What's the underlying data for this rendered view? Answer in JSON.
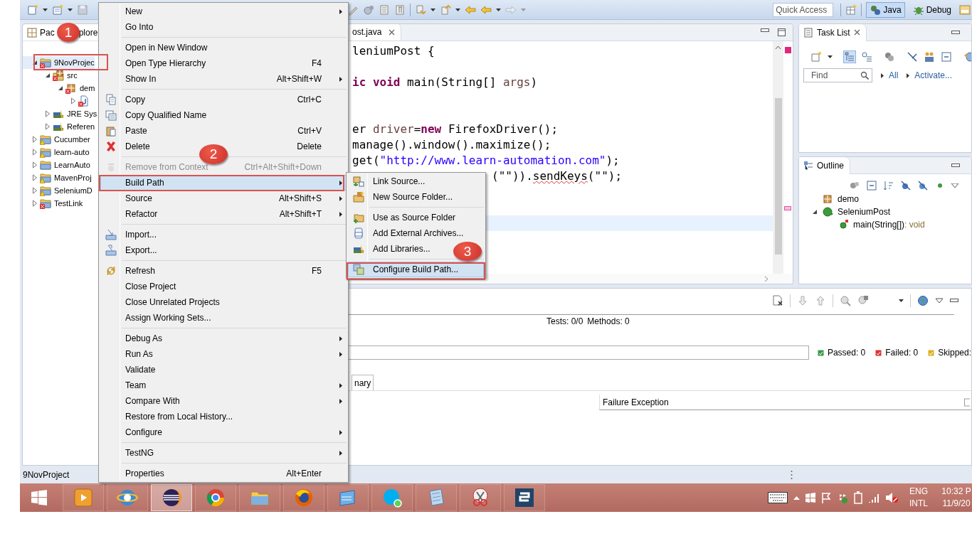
{
  "toolbar": {
    "quick_access": {
      "placeholder": "Quick Access"
    },
    "perspectives": [
      {
        "label": "Java",
        "selected": true
      },
      {
        "label": "Debug",
        "selected": false
      }
    ]
  },
  "package_explorer": {
    "title_parts": [
      "Pac",
      "plore"
    ],
    "tree": [
      {
        "label": "9NovProjec",
        "kind": "project",
        "error": true,
        "warning": false,
        "expanded": true,
        "selected": true,
        "children": [
          {
            "label": "src",
            "kind": "source-folder",
            "error": true,
            "warning": false,
            "expanded": true,
            "selected": false,
            "children": [
              {
                "label": "dem",
                "kind": "package",
                "error": true,
                "warning": false,
                "expanded": true,
                "selected": false,
                "children": [
                  {
                    "kind": "file",
                    "error": true,
                    "warning": false,
                    "expanded": false,
                    "selected": false
                  }
                ]
              }
            ]
          },
          {
            "label": "JRE Sys",
            "kind": "library",
            "error": false,
            "warning": false,
            "expanded": false,
            "selected": false
          },
          {
            "label": "Referen",
            "kind": "library",
            "error": false,
            "warning": false,
            "expanded": false,
            "selected": false
          }
        ]
      },
      {
        "label": "Cucumber",
        "kind": "project",
        "error": false,
        "warning": true,
        "expanded": false,
        "selected": false
      },
      {
        "label": "learn-auto",
        "kind": "project",
        "error": false,
        "warning": true,
        "expanded": false,
        "selected": false
      },
      {
        "label": "LearnAuto",
        "kind": "project",
        "error": false,
        "warning": false,
        "expanded": false,
        "selected": false
      },
      {
        "label": "MavenProj",
        "kind": "project",
        "error": false,
        "warning": true,
        "expanded": false,
        "selected": false
      },
      {
        "label": "SeleniumD",
        "kind": "project",
        "error": false,
        "warning": true,
        "expanded": false,
        "selected": false
      },
      {
        "label": "TestLink",
        "kind": "project",
        "error": true,
        "warning": false,
        "expanded": false,
        "selected": false
      }
    ]
  },
  "editor": {
    "tab": {
      "label": "ost.java"
    },
    "lines": [
      {
        "current": false,
        "segments": [
          {
            "kind": "plain",
            "text": "leniumPost {"
          }
        ]
      },
      {
        "current": false
      },
      {
        "current": false,
        "segments": [
          {
            "kind": "keyword",
            "text": "ic void"
          },
          {
            "kind": "plain",
            "text": " main(String[] "
          },
          {
            "kind": "variable",
            "text": "args"
          },
          {
            "kind": "plain",
            "text": ")"
          }
        ]
      },
      {
        "current": false
      },
      {
        "current": false
      },
      {
        "current": false,
        "segments": [
          {
            "kind": "plain",
            "text": "er "
          },
          {
            "kind": "variable",
            "text": "driver"
          },
          {
            "kind": "plain",
            "text": "="
          },
          {
            "kind": "keyword",
            "text": "new"
          },
          {
            "kind": "plain",
            "text": " FirefoxDriver();"
          }
        ]
      },
      {
        "current": false,
        "segments": [
          {
            "kind": "plain",
            "text": "manage().window().maximize();"
          }
        ]
      },
      {
        "current": false,
        "segments": [
          {
            "kind": "plain",
            "text": "get("
          },
          {
            "kind": "string",
            "text": "\"http://www.learn-automation.com\""
          },
          {
            "kind": "plain",
            "text": ");"
          }
        ]
      },
      {
        "current": false,
        "covered": true,
        "segments": [
          {
            "kind": "plain",
            "text": "(\"\"))."
          },
          {
            "kind": "warning",
            "text": "sendKeys"
          },
          {
            "kind": "plain",
            "text": "(\"\");"
          }
        ]
      },
      {
        "current": false
      },
      {
        "current": false
      },
      {
        "current": true
      }
    ]
  },
  "task_list": {
    "title": "Task List",
    "find": {
      "placeholder": "Find"
    },
    "links": [
      "All",
      "Activate..."
    ]
  },
  "outline": {
    "title": "Outline",
    "tree": [
      {
        "label": "demo",
        "kind": "package"
      },
      {
        "label": "SeleniumPost",
        "kind": "class",
        "expanded": true,
        "children": [
          {
            "label": "main(String[])",
            "type": " : void",
            "kind": "method"
          }
        ]
      }
    ]
  },
  "testng": {
    "tests": "Tests: 0/0",
    "methods": "Methods: 0",
    "progress": {
      "level": 0
    },
    "counters": [
      {
        "kind": "passed",
        "label": "Passed: 0"
      },
      {
        "kind": "failed",
        "label": "Failed: 0"
      },
      {
        "kind": "skipped",
        "label": "Skipped:"
      }
    ],
    "tab": "nary",
    "column": "Failure Exception"
  },
  "status_bar": {
    "text": "9NovProject"
  },
  "context_menu": {
    "items": [
      {
        "kind": "item",
        "label": "New",
        "submenu": true,
        "disabled": false,
        "selected": false
      },
      {
        "kind": "item",
        "label": "Go Into",
        "submenu": false,
        "disabled": false,
        "selected": false
      },
      {
        "kind": "separator"
      },
      {
        "kind": "item",
        "label": "Open in New Window",
        "submenu": false,
        "disabled": false,
        "selected": false
      },
      {
        "kind": "item",
        "label": "Open Type Hierarchy",
        "shortcut": "F4",
        "submenu": false,
        "disabled": false,
        "selected": false
      },
      {
        "kind": "item",
        "label": "Show In",
        "shortcut": "Alt+Shift+W",
        "submenu": true,
        "disabled": false,
        "selected": false
      },
      {
        "kind": "separator"
      },
      {
        "kind": "item",
        "label": "Copy",
        "shortcut": "Ctrl+C",
        "submenu": false,
        "disabled": false,
        "selected": false
      },
      {
        "kind": "item",
        "label": "Copy Qualified Name",
        "submenu": false,
        "disabled": false,
        "selected": false
      },
      {
        "kind": "item",
        "label": "Paste",
        "shortcut": "Ctrl+V",
        "submenu": false,
        "disabled": false,
        "selected": false
      },
      {
        "kind": "item",
        "label": "Delete",
        "shortcut": "Delete",
        "submenu": false,
        "disabled": false,
        "selected": false
      },
      {
        "kind": "separator"
      },
      {
        "kind": "item",
        "label": "Remove from Context",
        "shortcut": "Ctrl+Alt+Shift+Down",
        "submenu": false,
        "disabled": true,
        "selected": false
      },
      {
        "kind": "item",
        "label": "Build Path",
        "submenu": true,
        "disabled": false,
        "selected": true
      },
      {
        "kind": "item",
        "label": "Source",
        "shortcut": "Alt+Shift+S",
        "submenu": true,
        "disabled": false,
        "selected": false
      },
      {
        "kind": "item",
        "label": "Refactor",
        "shortcut": "Alt+Shift+T",
        "submenu": true,
        "disabled": false,
        "selected": false
      },
      {
        "kind": "separator"
      },
      {
        "kind": "item",
        "label": "Import...",
        "submenu": false,
        "disabled": false,
        "selected": false
      },
      {
        "kind": "item",
        "label": "Export...",
        "submenu": false,
        "disabled": false,
        "selected": false
      },
      {
        "kind": "separator"
      },
      {
        "kind": "item",
        "label": "Refresh",
        "shortcut": "F5",
        "submenu": false,
        "disabled": false,
        "selected": false
      },
      {
        "kind": "item",
        "label": "Close Project",
        "submenu": false,
        "disabled": false,
        "selected": false
      },
      {
        "kind": "item",
        "label": "Close Unrelated Projects",
        "submenu": false,
        "disabled": false,
        "selected": false
      },
      {
        "kind": "item",
        "label": "Assign Working Sets...",
        "submenu": false,
        "disabled": false,
        "selected": false
      },
      {
        "kind": "separator"
      },
      {
        "kind": "item",
        "label": "Debug As",
        "submenu": true,
        "disabled": false,
        "selected": false
      },
      {
        "kind": "item",
        "label": "Run As",
        "submenu": true,
        "disabled": false,
        "selected": false
      },
      {
        "kind": "item",
        "label": "Validate",
        "submenu": false,
        "disabled": false,
        "selected": false
      },
      {
        "kind": "item",
        "label": "Team",
        "submenu": true,
        "disabled": false,
        "selected": false
      },
      {
        "kind": "item",
        "label": "Compare With",
        "submenu": true,
        "disabled": false,
        "selected": false
      },
      {
        "kind": "item",
        "label": "Restore from Local History...",
        "submenu": false,
        "disabled": false,
        "selected": false
      },
      {
        "kind": "item",
        "label": "Configure",
        "submenu": true,
        "disabled": false,
        "selected": false
      },
      {
        "kind": "separator"
      },
      {
        "kind": "item",
        "label": "TestNG",
        "submenu": true,
        "disabled": false,
        "selected": false
      },
      {
        "kind": "separator"
      },
      {
        "kind": "item",
        "label": "Properties",
        "shortcut": "Alt+Enter",
        "submenu": false,
        "disabled": false,
        "selected": false
      }
    ]
  },
  "submenu": {
    "items": [
      {
        "kind": "item",
        "label": "Link Source...",
        "selected": false
      },
      {
        "kind": "item",
        "label": "New Source Folder...",
        "selected": false
      },
      {
        "kind": "separator"
      },
      {
        "kind": "item",
        "label": "Use as Source Folder",
        "selected": false
      },
      {
        "kind": "item",
        "label": "Add External Archives...",
        "selected": false
      },
      {
        "kind": "item",
        "label": "Add Libraries...",
        "selected": false
      },
      {
        "kind": "separator"
      },
      {
        "kind": "item",
        "label": "Configure Build Path...",
        "selected": true
      }
    ]
  },
  "annotations": [
    {
      "label": "1"
    },
    {
      "label": "2"
    },
    {
      "label": "3"
    }
  ],
  "taskbar": {
    "apps": [
      {
        "selected": false
      },
      {
        "selected": false
      },
      {
        "selected": true
      },
      {
        "selected": false
      },
      {
        "selected": false
      },
      {
        "selected": false
      },
      {
        "selected": false
      },
      {
        "selected": false
      },
      {
        "selected": false
      },
      {
        "selected": false
      },
      {
        "selected": false
      }
    ],
    "language": [
      "ENG",
      "INTL"
    ],
    "clock": [
      "10:32 P",
      "11/9/20"
    ]
  }
}
